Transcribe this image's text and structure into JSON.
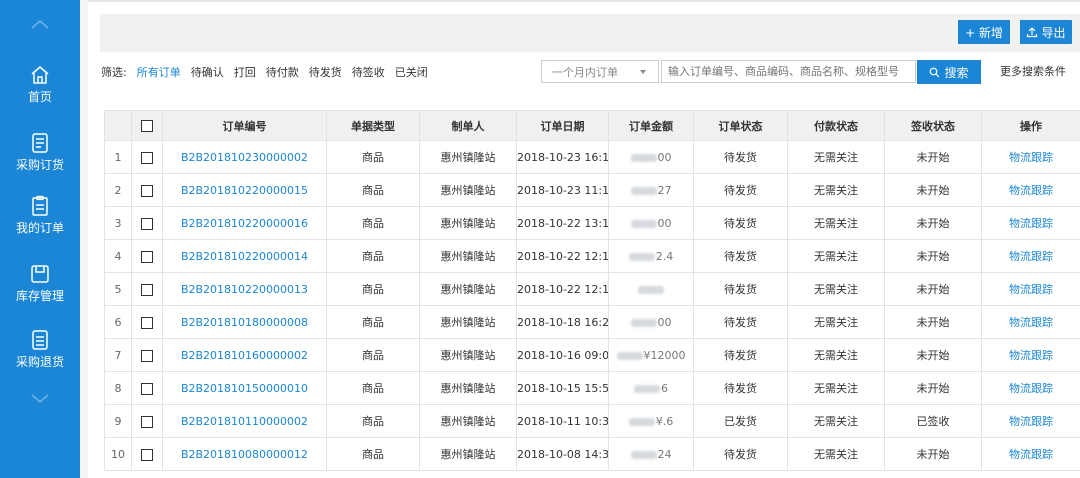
{
  "sidebar": {
    "items": [
      {
        "label": "首页",
        "icon": "home-icon"
      },
      {
        "label": "采购订货",
        "icon": "purchase-order-icon"
      },
      {
        "label": "我的订单",
        "icon": "my-orders-icon"
      },
      {
        "label": "库存管理",
        "icon": "inventory-icon"
      },
      {
        "label": "采购退货",
        "icon": "purchase-return-icon"
      }
    ]
  },
  "toolbar": {
    "add_label": "+ 新增",
    "export_label": "导出"
  },
  "filters": {
    "label": "筛选:",
    "items": [
      "所有订单",
      "待确认",
      "打回",
      "待付款",
      "待发货",
      "待签收",
      "已关闭"
    ],
    "active": "所有订单"
  },
  "search": {
    "period": "一个月内订单",
    "placeholder": "输入订单编号、商品编码、商品名称、规格型号",
    "button_label": "搜索",
    "more_label": "更多搜索条件"
  },
  "table": {
    "headers": [
      "订单编号",
      "单据类型",
      "制单人",
      "订单日期",
      "订单金额",
      "订单状态",
      "付款状态",
      "签收状态",
      "操作"
    ],
    "rows": [
      {
        "no": "1",
        "order_id": "B2B201810230000002",
        "type": "商品",
        "maker": "惠州镇隆站",
        "date": "2018-10-23 16:1...",
        "amount": "00",
        "status": "待发货",
        "pay": "无需关注",
        "sign": "未开始",
        "action": "物流跟踪"
      },
      {
        "no": "2",
        "order_id": "B2B201810220000015",
        "type": "商品",
        "maker": "惠州镇隆站",
        "date": "2018-10-23 11:1...",
        "amount": "27",
        "status": "待发货",
        "pay": "无需关注",
        "sign": "未开始",
        "action": "物流跟踪"
      },
      {
        "no": "3",
        "order_id": "B2B201810220000016",
        "type": "商品",
        "maker": "惠州镇隆站",
        "date": "2018-10-22 13:1...",
        "amount": "00",
        "status": "待发货",
        "pay": "无需关注",
        "sign": "未开始",
        "action": "物流跟踪"
      },
      {
        "no": "4",
        "order_id": "B2B201810220000014",
        "type": "商品",
        "maker": "惠州镇隆站",
        "date": "2018-10-22 12:1...",
        "amount": "2.4",
        "status": "待发货",
        "pay": "无需关注",
        "sign": "未开始",
        "action": "物流跟踪"
      },
      {
        "no": "5",
        "order_id": "B2B201810220000013",
        "type": "商品",
        "maker": "惠州镇隆站",
        "date": "2018-10-22 12:1...",
        "amount": "",
        "status": "待发货",
        "pay": "无需关注",
        "sign": "未开始",
        "action": "物流跟踪"
      },
      {
        "no": "6",
        "order_id": "B2B201810180000008",
        "type": "商品",
        "maker": "惠州镇隆站",
        "date": "2018-10-18 16:2...",
        "amount": "00",
        "status": "待发货",
        "pay": "无需关注",
        "sign": "未开始",
        "action": "物流跟踪"
      },
      {
        "no": "7",
        "order_id": "B2B201810160000002",
        "type": "商品",
        "maker": "惠州镇隆站",
        "date": "2018-10-16 09:0...",
        "amount": "¥12000",
        "status": "待发货",
        "pay": "无需关注",
        "sign": "未开始",
        "action": "物流跟踪"
      },
      {
        "no": "8",
        "order_id": "B2B201810150000010",
        "type": "商品",
        "maker": "惠州镇隆站",
        "date": "2018-10-15 15:5...",
        "amount": "6",
        "status": "待发货",
        "pay": "无需关注",
        "sign": "未开始",
        "action": "物流跟踪"
      },
      {
        "no": "9",
        "order_id": "B2B201810110000002",
        "type": "商品",
        "maker": "惠州镇隆站",
        "date": "2018-10-11 10:3...",
        "amount": "¥.6",
        "status": "已发货",
        "pay": "无需关注",
        "sign": "已签收",
        "action": "物流跟踪"
      },
      {
        "no": "10",
        "order_id": "B2B201810080000012",
        "type": "商品",
        "maker": "惠州镇隆站",
        "date": "2018-10-08 14:3...",
        "amount": "24",
        "status": "待发货",
        "pay": "无需关注",
        "sign": "未开始",
        "action": "物流跟踪"
      }
    ]
  },
  "colors": {
    "accent": "#1b86d6",
    "sidebar_bg": "#1b86d6"
  }
}
